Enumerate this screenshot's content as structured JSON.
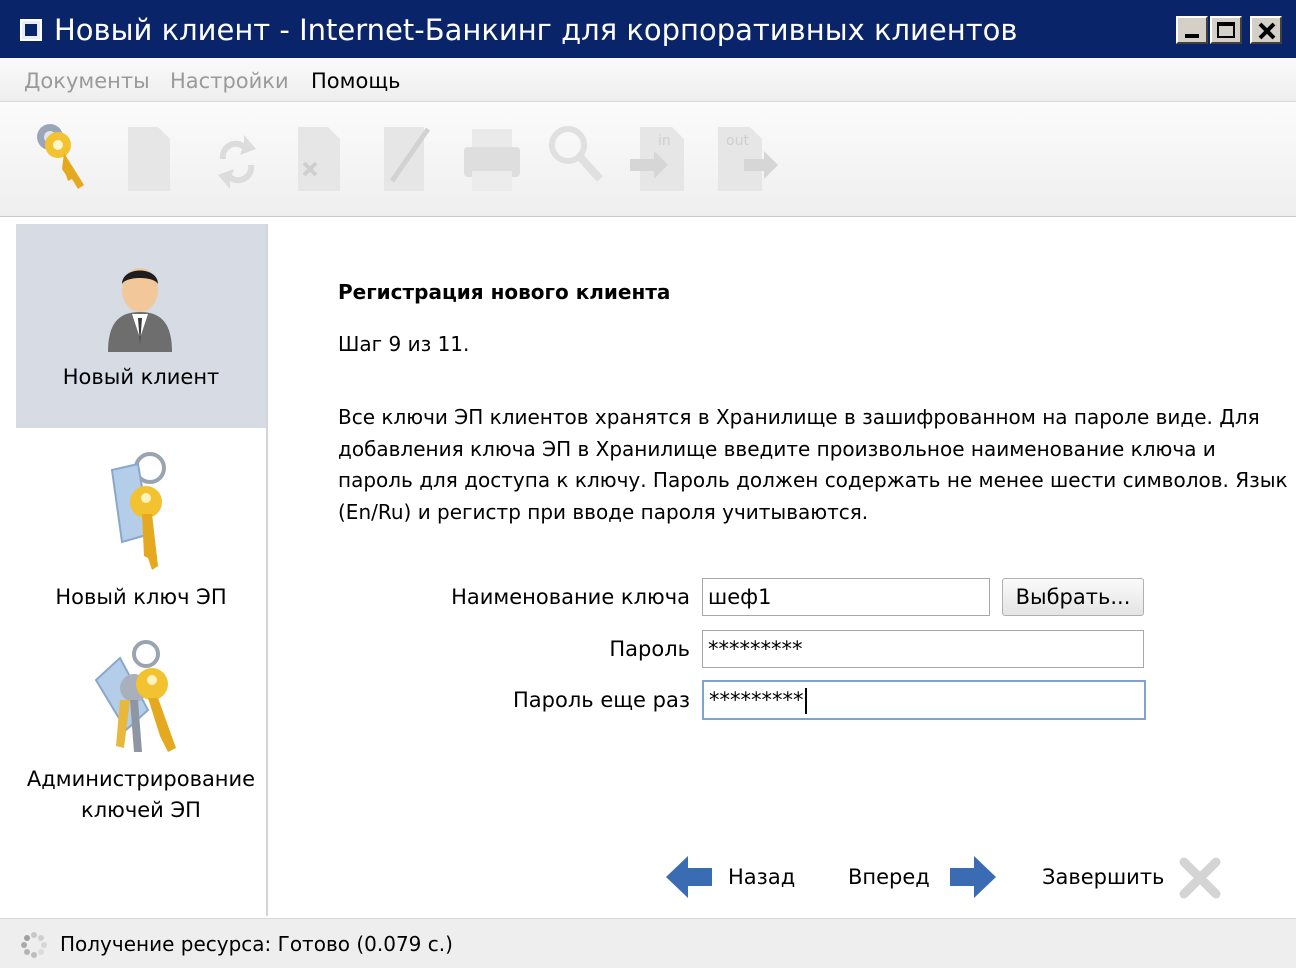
{
  "window": {
    "title": "Новый клиент - Internet-Банкинг для корпоративных клиентов"
  },
  "menu": [
    {
      "label": "Документы",
      "enabled": false
    },
    {
      "label": "Настройки",
      "enabled": false
    },
    {
      "label": "Помощь",
      "enabled": true
    }
  ],
  "toolbar": {
    "icons": [
      "key-icon",
      "new-document-icon",
      "refresh-icon",
      "delete-document-icon",
      "edit-document-icon",
      "print-icon",
      "search-icon",
      "import-in-icon",
      "export-out-icon"
    ],
    "in_label": "in",
    "out_label": "out"
  },
  "sidebar": {
    "items": [
      {
        "label": "Новый клиент",
        "icon": "user-icon",
        "selected": true
      },
      {
        "label": "Новый ключ ЭП",
        "icon": "key-tag-icon",
        "selected": false
      },
      {
        "label": "Администрирование ключей ЭП",
        "label_line1": "Администрирование",
        "label_line2": "ключей ЭП",
        "icon": "keys-bunch-icon",
        "selected": false
      }
    ]
  },
  "wizard": {
    "heading": "Регистрация нового клиента",
    "step": "Шаг 9 из 11.",
    "description": "Все ключи ЭП клиентов хранятся в Хранилище в зашифрованном на пароле виде. Для добавления ключа ЭП в Хранилище введите произвольное наименование ключа и пароль для доступа к ключу. Пароль должен содержать не менее шести символов. Язык (En/Ru) и регистр при вводе пароля учитываются.",
    "fields": {
      "key_name_label": "Наименование ключа",
      "key_name_value": "шеф1",
      "choose_button": "Выбрать...",
      "password_label": "Пароль",
      "password_value": "*********",
      "password_repeat_label": "Пароль еще раз",
      "password_repeat_value": "*********"
    },
    "nav": {
      "back": "Назад",
      "forward": "Вперед",
      "finish": "Завершить"
    }
  },
  "status": {
    "text": "Получение ресурса: Готово (0.079 с.)"
  },
  "colors": {
    "titlebar": "#0a246a",
    "selected_sidebar": "#d6dbe4",
    "arrow_blue": "#3a6cb4",
    "focus_border": "#7fa2d0"
  }
}
